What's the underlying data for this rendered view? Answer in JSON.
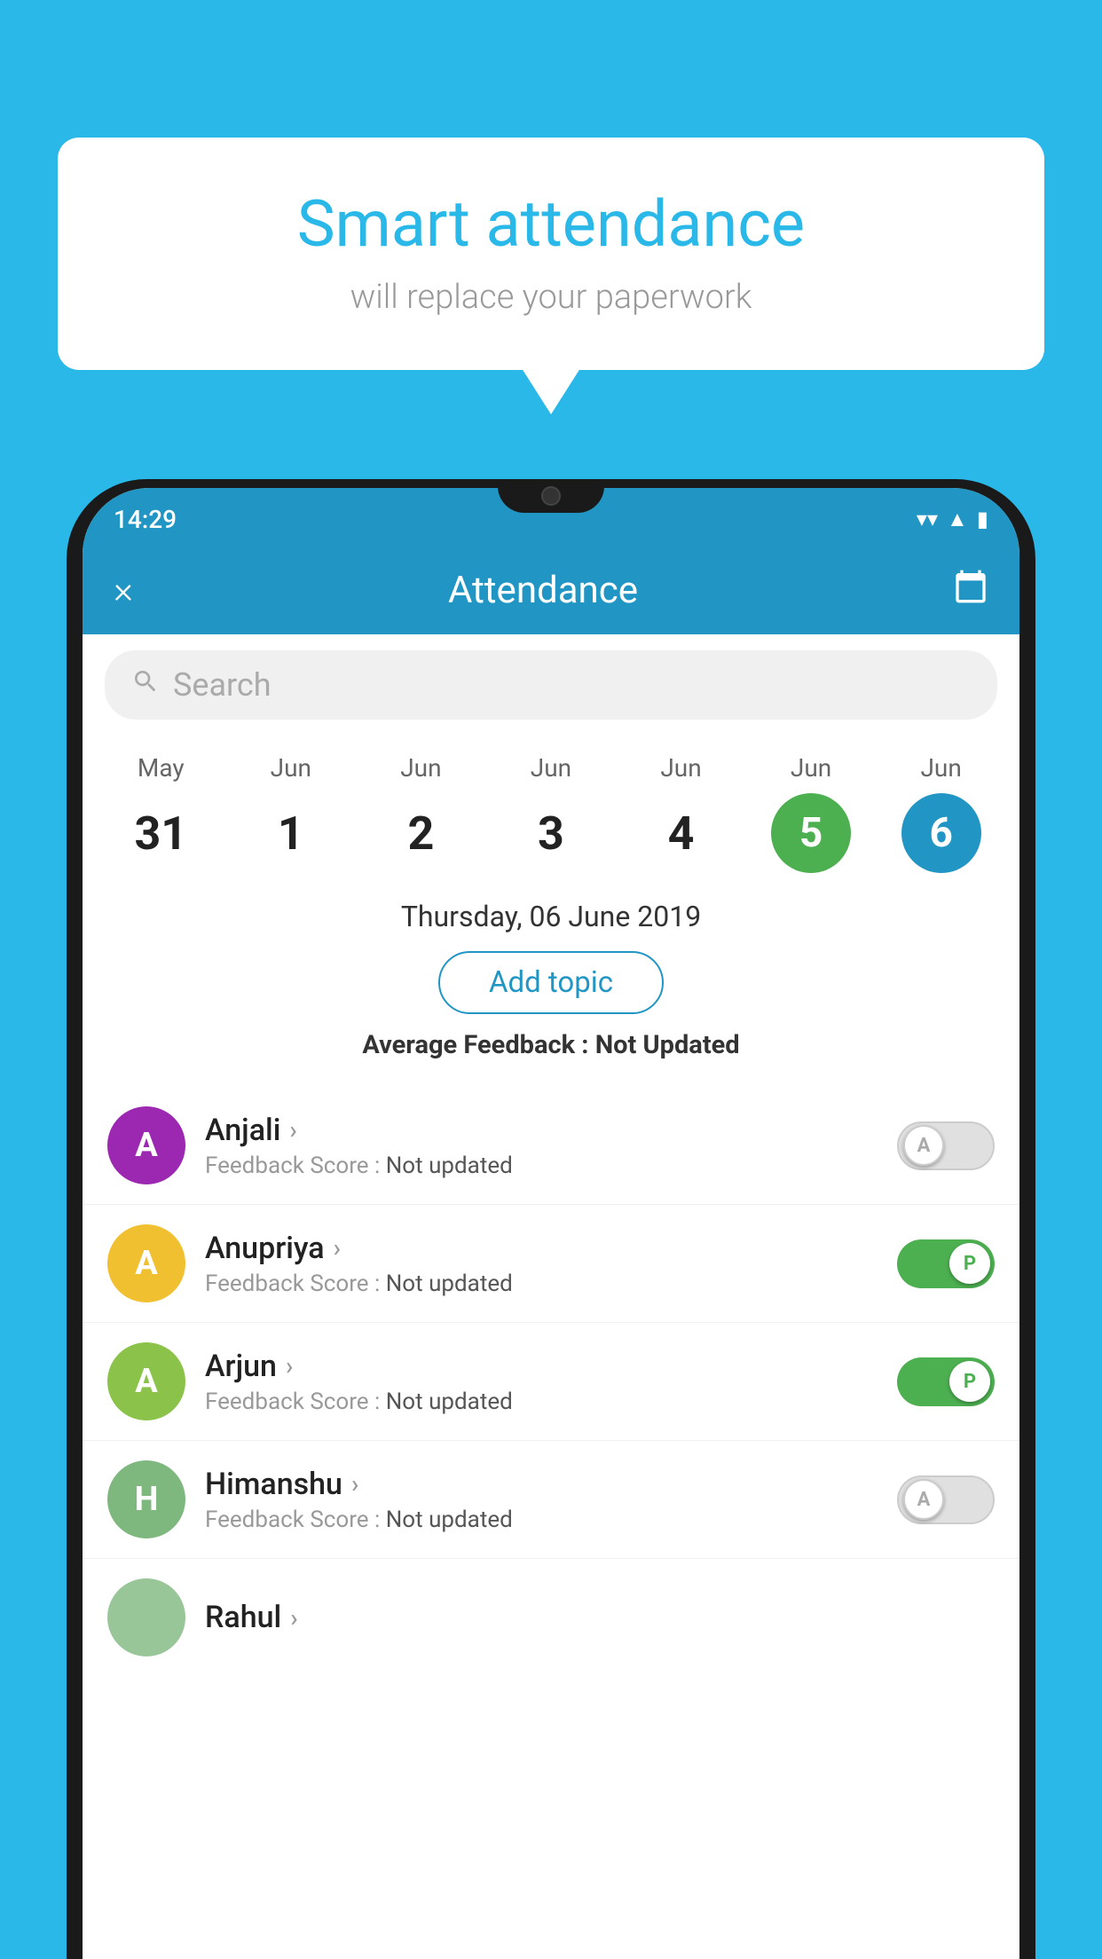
{
  "background_color": "#29b8e8",
  "bubble": {
    "title": "Smart attendance",
    "subtitle": "will replace your paperwork"
  },
  "status_bar": {
    "time": "14:29",
    "wifi": "▼",
    "signal": "▲",
    "battery": "▮"
  },
  "header": {
    "title": "Attendance",
    "close_label": "×",
    "calendar_label": "📅"
  },
  "search": {
    "placeholder": "Search"
  },
  "calendar": {
    "dates": [
      {
        "month": "May",
        "day": "31",
        "style": "normal"
      },
      {
        "month": "Jun",
        "day": "1",
        "style": "normal"
      },
      {
        "month": "Jun",
        "day": "2",
        "style": "normal"
      },
      {
        "month": "Jun",
        "day": "3",
        "style": "normal"
      },
      {
        "month": "Jun",
        "day": "4",
        "style": "normal"
      },
      {
        "month": "Jun",
        "day": "5",
        "style": "green"
      },
      {
        "month": "Jun",
        "day": "6",
        "style": "blue"
      }
    ]
  },
  "selected_date": {
    "text": "Thursday, 06 June 2019",
    "add_topic_label": "Add topic",
    "avg_feedback_label": "Average Feedback :",
    "avg_feedback_value": "Not Updated"
  },
  "students": [
    {
      "name": "Anjali",
      "avatar_letter": "A",
      "avatar_color": "purple",
      "feedback": "Feedback Score : Not updated",
      "status": "absent",
      "toggle_label": "A"
    },
    {
      "name": "Anupriya",
      "avatar_letter": "A",
      "avatar_color": "yellow",
      "feedback": "Feedback Score : Not updated",
      "status": "present",
      "toggle_label": "P"
    },
    {
      "name": "Arjun",
      "avatar_letter": "A",
      "avatar_color": "green",
      "feedback": "Feedback Score : Not updated",
      "status": "present",
      "toggle_label": "P"
    },
    {
      "name": "Himanshu",
      "avatar_letter": "H",
      "avatar_color": "teal",
      "feedback": "Feedback Score : Not updated",
      "status": "absent",
      "toggle_label": "A"
    }
  ]
}
